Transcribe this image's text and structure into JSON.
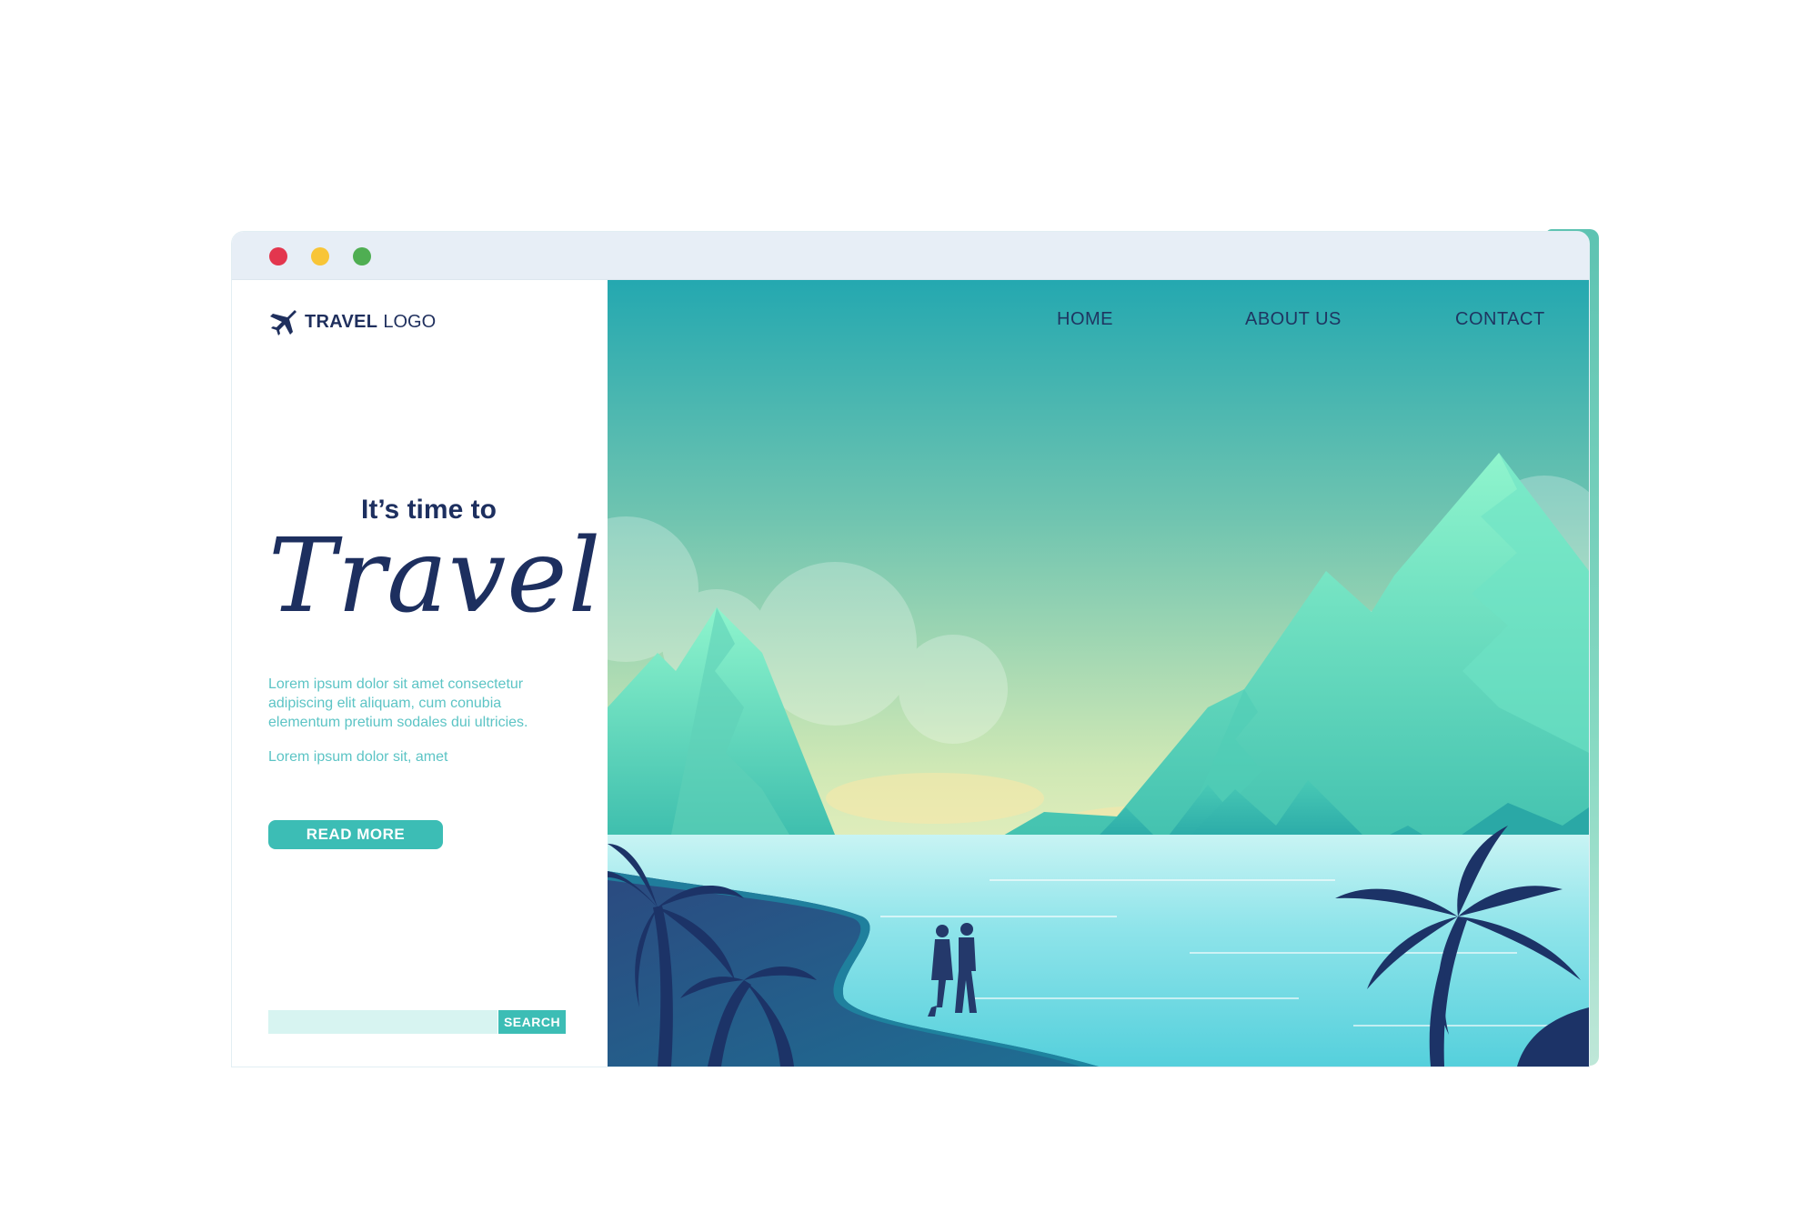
{
  "logo": {
    "strong": "TRAVEL",
    "light": "LOGO",
    "icon": "airplane-icon"
  },
  "nav": {
    "home": "HOME",
    "about": "ABOUT US",
    "contact": "CONTACT"
  },
  "hero": {
    "line1": "It’s time to",
    "line2": "Travel",
    "paragraph1": "Lorem ipsum dolor sit amet consectetur adipiscing elit aliquam, cum conubia elementum pretium sodales dui ultricies.",
    "paragraph2": "Lorem ipsum dolor sit, amet",
    "read_more": "READ MORE"
  },
  "search": {
    "button": "SEARCH",
    "value": ""
  },
  "colors": {
    "accent": "#3cbdb5",
    "navy": "#1d2f5f",
    "titlebar": "#e7eef6",
    "dot_red": "#e3364e",
    "dot_yellow": "#f8c537",
    "dot_green": "#4fae52"
  }
}
